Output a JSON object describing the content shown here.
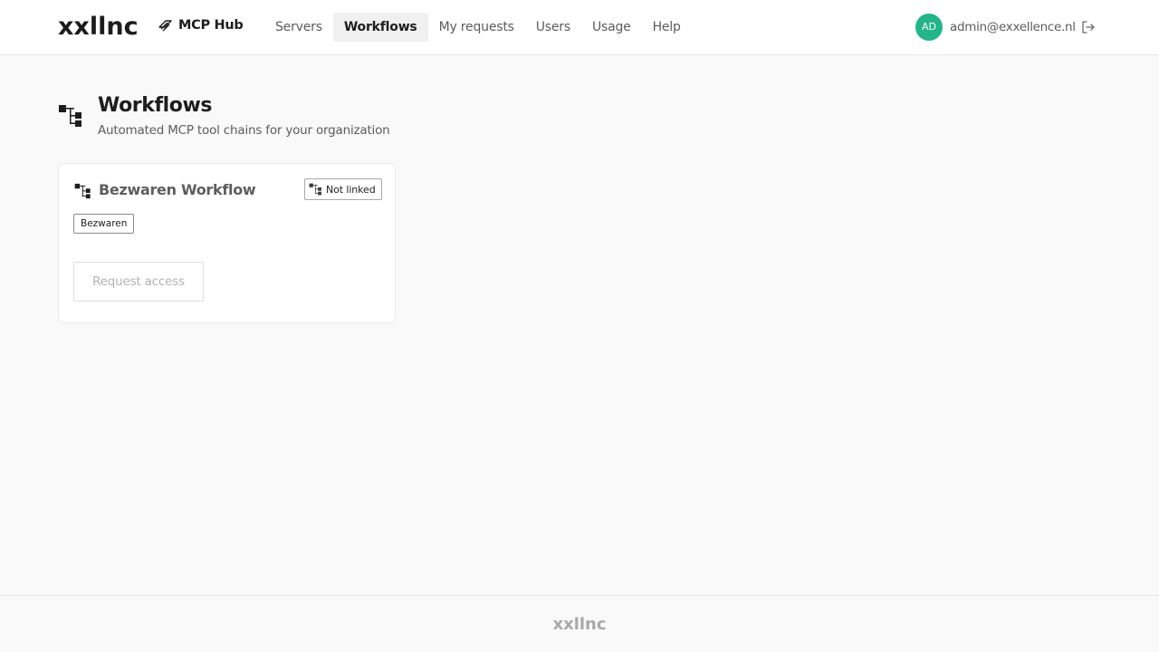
{
  "header": {
    "logo_text": "xxllnc",
    "app_name": "MCP Hub",
    "nav": [
      {
        "label": "Servers",
        "active": false
      },
      {
        "label": "Workflows",
        "active": true
      },
      {
        "label": "My requests",
        "active": false
      },
      {
        "label": "Users",
        "active": false
      },
      {
        "label": "Usage",
        "active": false
      },
      {
        "label": "Help",
        "active": false
      }
    ],
    "user": {
      "initials": "AD",
      "email": "admin@exxellence.nl",
      "avatar_color": "#25b48a"
    },
    "icons": {
      "app": "stack-layers-icon",
      "logout": "logout-icon"
    }
  },
  "page": {
    "title": "Workflows",
    "subtitle": "Automated MCP tool chains for your organization",
    "icon": "workflow-tree-icon"
  },
  "cards": [
    {
      "title": "Bezwaren Workflow",
      "status": "Not linked",
      "tags": [
        "Bezwaren"
      ],
      "action": "Request access",
      "action_enabled": false
    }
  ],
  "footer": {
    "logo_text": "xxllnc"
  }
}
